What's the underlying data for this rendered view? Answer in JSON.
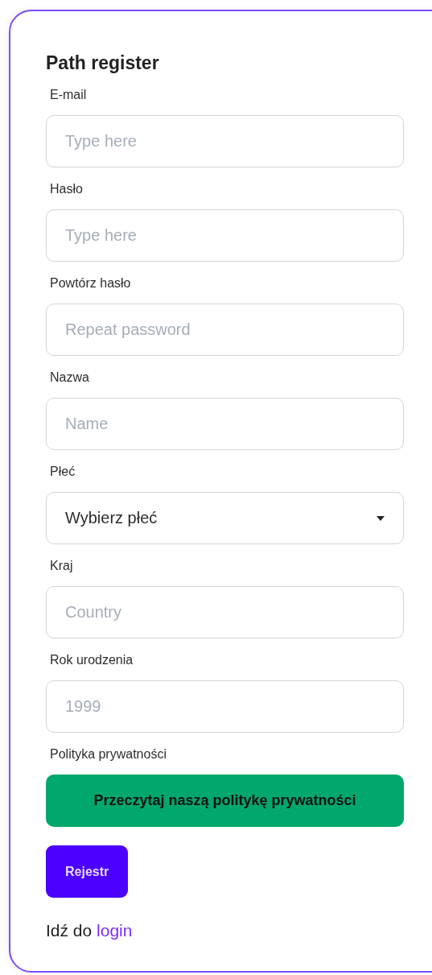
{
  "form": {
    "title": "Path register",
    "fields": [
      {
        "kind": "input",
        "label": "E-mail",
        "placeholder": "Type here"
      },
      {
        "kind": "input",
        "label": "Hasło",
        "placeholder": "Type here"
      },
      {
        "kind": "input",
        "label": "Powtórz hasło",
        "placeholder": "Repeat password"
      },
      {
        "kind": "input",
        "label": "Nazwa",
        "placeholder": "Name"
      },
      {
        "kind": "select",
        "label": "Płeć",
        "value": "Wybierz płeć"
      },
      {
        "kind": "input",
        "label": "Kraj",
        "placeholder": "Country"
      },
      {
        "kind": "input",
        "label": "Rok urodzenia",
        "placeholder": "1999"
      },
      {
        "kind": "button",
        "label": "Polityka prywatności",
        "text": "Przeczytaj naszą politykę prywatności"
      }
    ],
    "submit": "Rejestr",
    "footer": {
      "text": "Idź do",
      "link": "login"
    }
  }
}
